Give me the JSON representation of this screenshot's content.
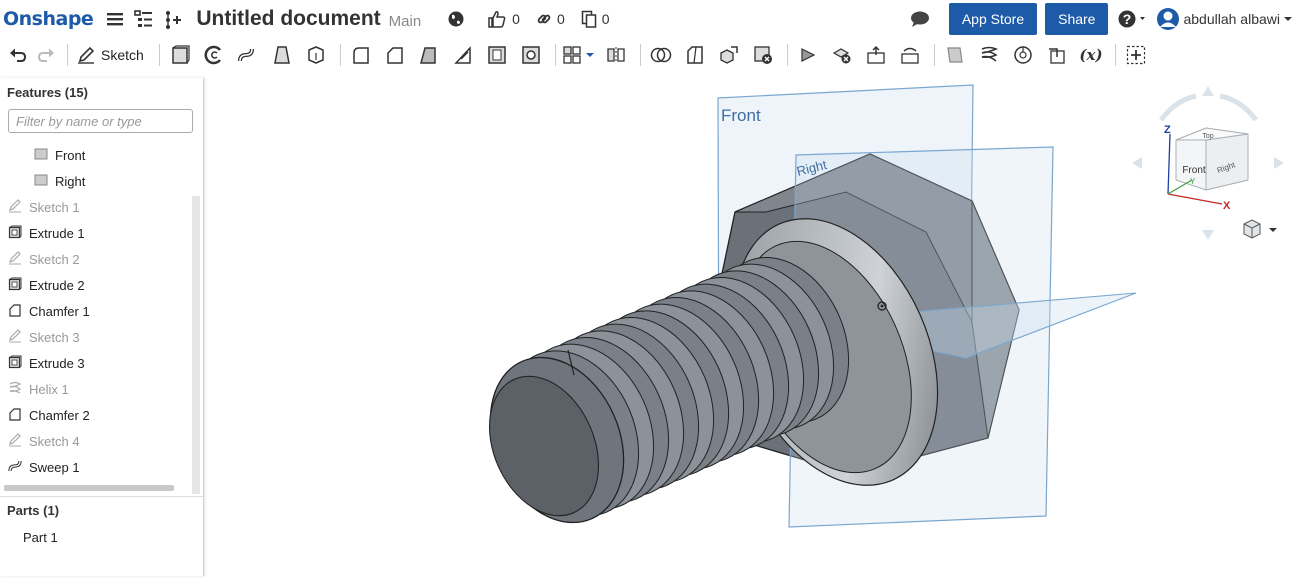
{
  "app": {
    "logo": "Onshape"
  },
  "document": {
    "title": "Untitled document",
    "branch": "Main"
  },
  "stats": {
    "likes": "0",
    "links": "0",
    "copies": "0"
  },
  "header": {
    "app_store_label": "App Store",
    "share_label": "Share",
    "user_name": "abdullah albawi"
  },
  "toolbar": {
    "sketch_label": "Sketch"
  },
  "features": {
    "title": "Features (15)",
    "filter_placeholder": "Filter by name or type",
    "items": [
      {
        "label": "Front",
        "icon": "plane-icon",
        "kind": "plane"
      },
      {
        "label": "Right",
        "icon": "plane-icon",
        "kind": "plane"
      },
      {
        "label": "Sketch 1",
        "icon": "sketch-icon",
        "kind": "dim"
      },
      {
        "label": "Extrude 1",
        "icon": "extrude-icon",
        "kind": "normal"
      },
      {
        "label": "Sketch 2",
        "icon": "sketch-icon",
        "kind": "dim"
      },
      {
        "label": "Extrude 2",
        "icon": "extrude-icon",
        "kind": "normal"
      },
      {
        "label": "Chamfer 1",
        "icon": "chamfer-icon",
        "kind": "normal"
      },
      {
        "label": "Sketch 3",
        "icon": "sketch-icon",
        "kind": "dim"
      },
      {
        "label": "Extrude 3",
        "icon": "extrude-icon",
        "kind": "normal"
      },
      {
        "label": "Helix 1",
        "icon": "helix-icon",
        "kind": "dim"
      },
      {
        "label": "Chamfer 2",
        "icon": "chamfer-icon",
        "kind": "normal"
      },
      {
        "label": "Sketch 4",
        "icon": "sketch-icon",
        "kind": "dim"
      },
      {
        "label": "Sweep 1",
        "icon": "sweep-icon",
        "kind": "normal"
      }
    ]
  },
  "parts": {
    "title": "Parts (1)",
    "items": [
      {
        "label": "Part 1"
      }
    ]
  },
  "viewport": {
    "plane_front_label": "Front",
    "plane_right_label": "Right"
  },
  "view_cube": {
    "front_label": "Front",
    "right_label": "Right",
    "top_label": "Top",
    "axis_x": "X",
    "axis_y": "Y",
    "axis_z": "Z"
  },
  "colors": {
    "brand": "#1d5aa8",
    "plane_fill": "#c9dcee",
    "plane_stroke": "#7aa6cf",
    "part_fill": "#6b7178"
  }
}
